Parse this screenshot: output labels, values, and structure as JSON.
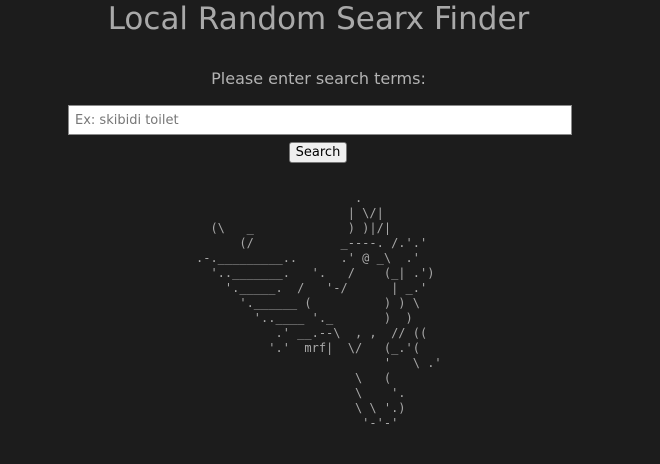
{
  "page": {
    "title": "Local Random Searx Finder",
    "prompt": "Please enter search terms:"
  },
  "search": {
    "placeholder": "Ex: skibidi toilet",
    "value": "",
    "button_label": "Search"
  },
  "ascii_art": "                      .\n                     | \\/|\n  (\\   _             ) )|/|\n      (/            _----. /.'.'\n.-._________..      .' @ _\\  .'\n  '.._______.   '.   /    (_| .')\n    '._____.  /   '-/      | _.'\n      '.______ (          ) ) \\\n        '..____ '._       )  )\n           .' __.--\\  , ,  // ((\n          '.'  mrf|  \\/   (_.'(\n                          '   \\ .'\n                      \\   (\n                      \\    '.\n                      \\ \\ '.)\n                       '-'-'"
}
